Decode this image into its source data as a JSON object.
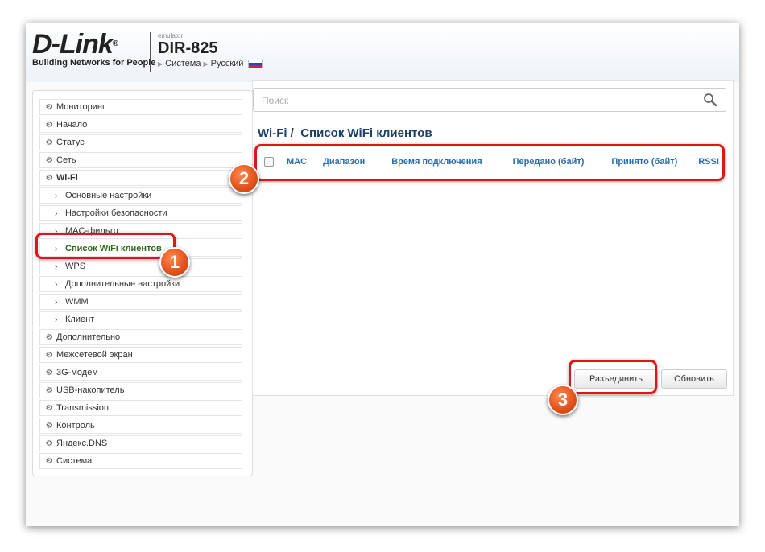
{
  "header": {
    "logo_text": "D-Link",
    "logo_reg": "®",
    "tagline": "Building Networks for People",
    "emulator_label": "emulator",
    "model": "DIR-825",
    "crumb_system": "Система",
    "crumb_language": "Русский"
  },
  "sidebar": {
    "items": [
      {
        "label": "Мониторинг"
      },
      {
        "label": "Начало"
      },
      {
        "label": "Статус"
      },
      {
        "label": "Сеть"
      },
      {
        "label": "Wi-Fi"
      },
      {
        "label": "Основные настройки"
      },
      {
        "label": "Настройки безопасности"
      },
      {
        "label": "MAC-фильтр"
      },
      {
        "label": "Список WiFi клиентов"
      },
      {
        "label": "WPS"
      },
      {
        "label": "Дополнительные настройки"
      },
      {
        "label": "WMM"
      },
      {
        "label": "Клиент"
      },
      {
        "label": "Дополнительно"
      },
      {
        "label": "Межсетевой экран"
      },
      {
        "label": "3G-модем"
      },
      {
        "label": "USB-накопитель"
      },
      {
        "label": "Transmission"
      },
      {
        "label": "Контроль"
      },
      {
        "label": "Яндекс.DNS"
      },
      {
        "label": "Система"
      }
    ]
  },
  "search": {
    "placeholder": "Поиск"
  },
  "page": {
    "section": "Wi-Fi /",
    "title": "Список WiFi клиентов"
  },
  "table": {
    "columns": [
      "MAC",
      "Диапазон",
      "Время подключения",
      "Передано (байт)",
      "Принято (байт)",
      "RSSI"
    ]
  },
  "buttons": {
    "disconnect": "Разъединить",
    "refresh": "Обновить"
  },
  "annotations": [
    "1",
    "2",
    "3"
  ],
  "colors": {
    "accent_green": "#2f6a1a",
    "header_blue": "#2a6dae",
    "highlight_red": "#e01515",
    "badge_orange": "#e0501a"
  }
}
